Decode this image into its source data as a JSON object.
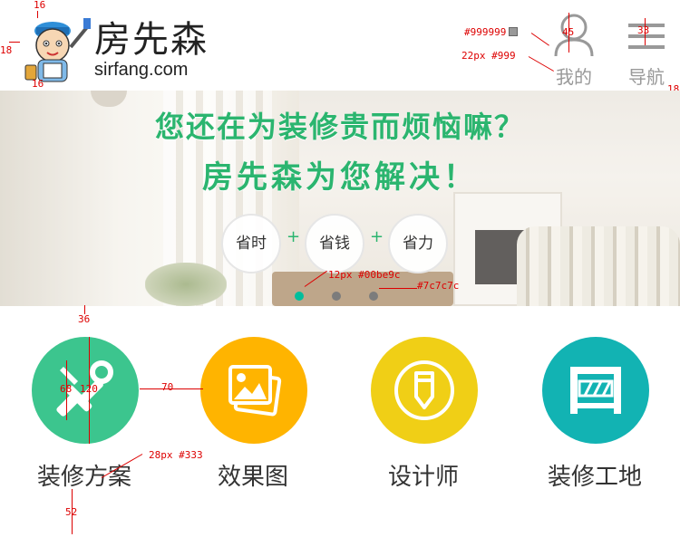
{
  "header": {
    "brand_cn": "房先森",
    "brand_en": "sirfang.com",
    "me_label": "我的",
    "nav_label": "导航"
  },
  "banner": {
    "headline": "您还在为装修贵而烦恼嘛？",
    "subheadline": "房先森为您解决！",
    "pills": [
      "省时",
      "省钱",
      "省力"
    ],
    "plus": "+",
    "dots": [
      {
        "color": "#00be9c",
        "active": true
      },
      {
        "color": "#7c7c7c",
        "active": false
      },
      {
        "color": "#7c7c7c",
        "active": false
      }
    ]
  },
  "services": [
    {
      "label": "装修方案",
      "icon": "tools-icon",
      "color": "#3cc58e"
    },
    {
      "label": "效果图",
      "icon": "gallery-icon",
      "color": "#ffb400"
    },
    {
      "label": "设计师",
      "icon": "pencil-icon",
      "color": "#f0cf16"
    },
    {
      "label": "装修工地",
      "icon": "construction-icon",
      "color": "#12b3b3"
    }
  ],
  "annotations": {
    "logo_top": "16",
    "logo_bottom": "16",
    "logo_left": "18",
    "icon_color": "#999999",
    "label_spec": "22px  #999",
    "me_icon_size": "45",
    "nav_icon_size": "33",
    "right_margin": "18",
    "dot_active_spec": "12px #00be9c",
    "dot_inactive_spec": "#7c7c7c",
    "grid_top": "36",
    "circle_size": "120",
    "icon_size": "68",
    "grid_gap": "70",
    "label_spec2": "28px #333",
    "grid_bottom": "52"
  },
  "colors": {
    "brand_green": "#2bb56f",
    "label_gray": "#999999",
    "text_dark": "#333333"
  }
}
